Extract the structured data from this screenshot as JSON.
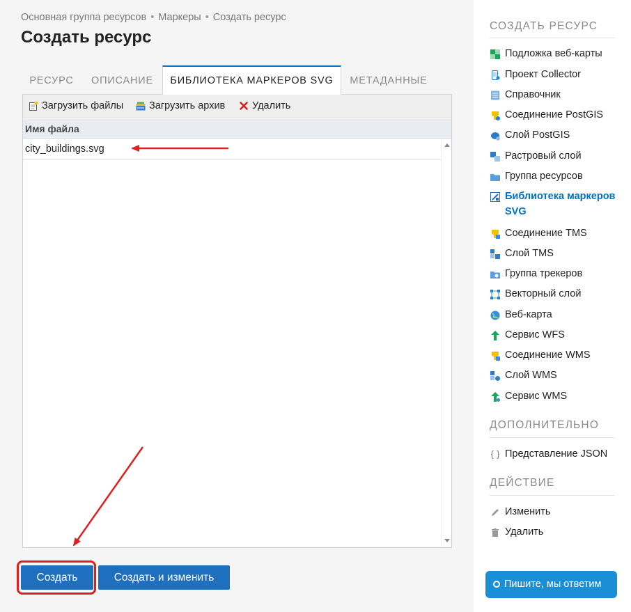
{
  "breadcrumb": [
    "Основная группа ресурсов",
    "Маркеры",
    "Создать ресурс"
  ],
  "breadcrumb_separator": "•",
  "page_title": "Создать ресурс",
  "tabs": [
    {
      "label": "РЕСУРС",
      "active": false
    },
    {
      "label": "ОПИСАНИЕ",
      "active": false
    },
    {
      "label": "БИБЛИОТЕКА МАРКЕРОВ SVG",
      "active": true
    },
    {
      "label": "МЕТАДАННЫЕ",
      "active": false
    }
  ],
  "toolbar": {
    "upload_files": "Загрузить файлы",
    "upload_archive": "Загрузить архив",
    "delete": "Удалить"
  },
  "grid": {
    "column_header": "Имя файла",
    "rows": [
      "city_buildings.svg"
    ]
  },
  "actions": {
    "create": "Создать",
    "create_and_edit": "Создать и изменить"
  },
  "sidebar": {
    "create_heading": "СОЗДАТЬ РЕСУРС",
    "create_items": [
      {
        "label": "Подложка веб-карты",
        "icon": "basemap-icon",
        "active": false
      },
      {
        "label": "Проект Collector",
        "icon": "collector-icon",
        "active": false
      },
      {
        "label": "Справочник",
        "icon": "lookup-table-icon",
        "active": false
      },
      {
        "label": "Соединение PostGIS",
        "icon": "postgis-connection-icon",
        "active": false
      },
      {
        "label": "Слой PostGIS",
        "icon": "postgis-layer-icon",
        "active": false
      },
      {
        "label": "Растровый слой",
        "icon": "raster-layer-icon",
        "active": false
      },
      {
        "label": "Группа ресурсов",
        "icon": "folder-icon",
        "active": false
      },
      {
        "label": "Библиотека маркеров SVG",
        "icon": "svg-library-icon",
        "active": true
      },
      {
        "label": "Соединение TMS",
        "icon": "tms-connection-icon",
        "active": false
      },
      {
        "label": "Слой TMS",
        "icon": "tms-layer-icon",
        "active": false
      },
      {
        "label": "Группа трекеров",
        "icon": "tracker-group-icon",
        "active": false
      },
      {
        "label": "Векторный слой",
        "icon": "vector-layer-icon",
        "active": false
      },
      {
        "label": "Веб-карта",
        "icon": "webmap-icon",
        "active": false
      },
      {
        "label": "Сервис WFS",
        "icon": "wfs-service-icon",
        "active": false
      },
      {
        "label": "Соединение WMS",
        "icon": "wms-connection-icon",
        "active": false
      },
      {
        "label": "Слой WMS",
        "icon": "wms-layer-icon",
        "active": false
      },
      {
        "label": "Сервис WMS",
        "icon": "wms-service-icon",
        "active": false
      }
    ],
    "extra_heading": "ДОПОЛНИТЕЛЬНО",
    "extra_items": [
      {
        "label": "Представление JSON",
        "icon": "json-braces-icon"
      }
    ],
    "action_heading": "ДЕЙСТВИЕ",
    "action_items": [
      {
        "label": "Изменить",
        "icon": "pencil-icon"
      },
      {
        "label": "Удалить",
        "icon": "trash-icon"
      }
    ]
  },
  "chat_button": "Пишите, мы ответим",
  "colors": {
    "accent": "#0070c5",
    "button": "#1f6fbf",
    "annotation": "#e02020",
    "chat": "#1a8fd8"
  }
}
